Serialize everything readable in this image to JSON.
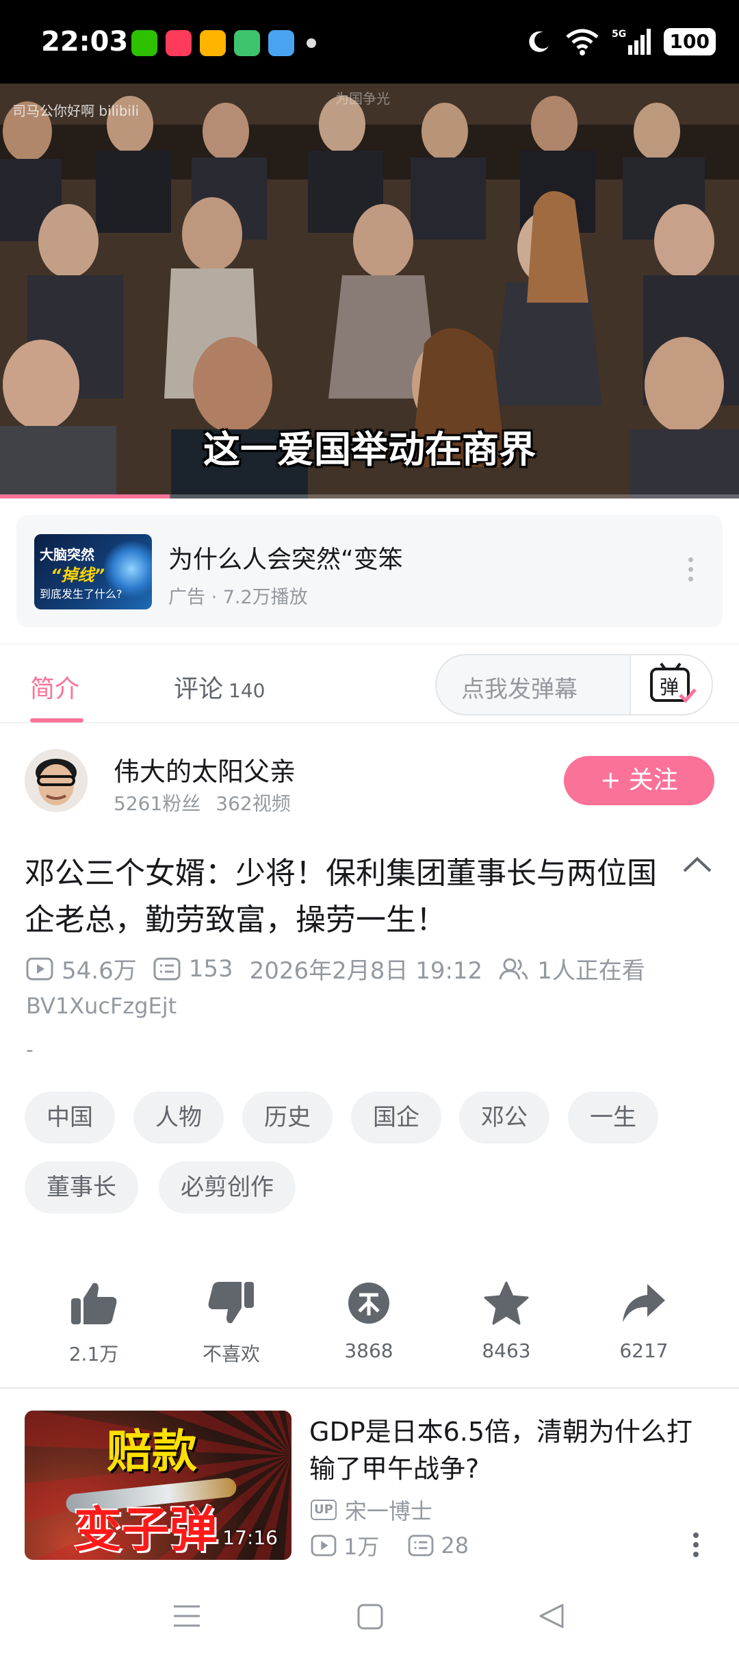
{
  "status_bar": {
    "time": "22:03",
    "battery": "100",
    "network": "5G"
  },
  "video": {
    "watermark_left": "司马公你好啊 bilibili",
    "watermark_center": "为国争光",
    "subtitle": "这一爱国举动在商界",
    "progress": 0.23
  },
  "ad": {
    "thumb_line1": "大脑突然",
    "thumb_line2": "“掉线”",
    "thumb_line3": "到底发生了什么?",
    "title": "为什么人会突然“变笨",
    "meta": "广告 · 7.2万播放"
  },
  "tabs": {
    "intro": "简介",
    "comments": "评论",
    "comments_count": "140",
    "danmaku_placeholder": "点我发弹幕",
    "danmaku_icon_text": "弹"
  },
  "uploader": {
    "name": "伟大的太阳父亲",
    "fans": "5261粉丝",
    "videos": "362视频",
    "follow": "+ 关注"
  },
  "video_info": {
    "title": "邓公三个女婿：少将！保利集团董事长与两位国企老总，勤劳致富，操劳一生！",
    "views": "54.6万",
    "danmaku": "153",
    "date": "2026年2月8日 19:12",
    "watching": "1人正在看",
    "bvid": "BV1XucFzgEjt",
    "description": "-"
  },
  "tags": [
    "中国",
    "人物",
    "历史",
    "国企",
    "邓公",
    "一生",
    "董事长",
    "必剪创作"
  ],
  "actions": [
    {
      "name": "like",
      "label": "2.1万"
    },
    {
      "name": "dislike",
      "label": "不喜欢"
    },
    {
      "name": "coin",
      "label": "3868"
    },
    {
      "name": "favorite",
      "label": "8463"
    },
    {
      "name": "share",
      "label": "6217"
    }
  ],
  "recommended": {
    "thumb_text1": "赔款",
    "thumb_text2": "变子弹",
    "duration": "17:16",
    "title": "GDP是日本6.5倍，清朝为什么打输了甲午战争?",
    "up_badge": "UP",
    "uploader": "宋一博士",
    "views": "1万",
    "danmaku": "28"
  },
  "colors": {
    "accent": "#fb7299",
    "text": "#18191c",
    "muted": "#9499a0"
  }
}
